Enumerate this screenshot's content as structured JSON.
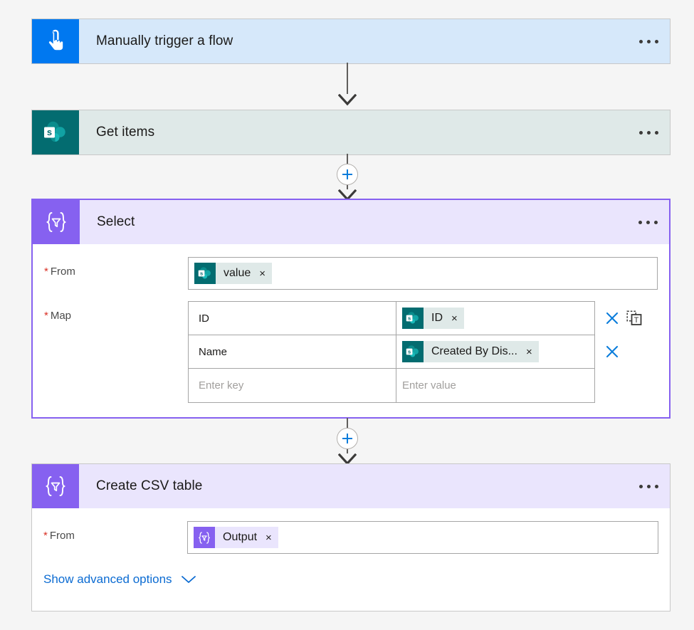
{
  "flow": {
    "trigger": {
      "title": "Manually trigger a flow",
      "icon": "manual-trigger-hand-icon",
      "menu_label": "more-commands",
      "accent": "#0078f0",
      "header_bg": "#d6e8fa"
    },
    "steps": [
      {
        "id": "get-items",
        "title": "Get items",
        "icon": "sharepoint-icon",
        "accent": "#036c70",
        "header_bg": "#dfe9e8"
      },
      {
        "id": "select",
        "title": "Select",
        "icon": "select-braces-filter-icon",
        "accent": "#8661f0",
        "header_bg": "#eae5fd",
        "selected": true,
        "fields": {
          "from": {
            "label": "From",
            "required": true,
            "token": {
              "text": "value",
              "source": "sharepoint",
              "remove": "×"
            }
          },
          "map": {
            "label": "Map",
            "required": true,
            "rows": [
              {
                "key": "ID",
                "key_placeholder": "",
                "value_token": {
                  "text": "ID",
                  "source": "sharepoint",
                  "remove": "×"
                },
                "value_placeholder": "",
                "actions": [
                  "delete-row-icon",
                  "paste-as-text-icon"
                ]
              },
              {
                "key": "Name",
                "key_placeholder": "",
                "value_token": {
                  "text": "Created By Dis...",
                  "source": "sharepoint",
                  "remove": "×"
                },
                "value_placeholder": "",
                "actions": [
                  "delete-row-icon"
                ]
              },
              {
                "key": "",
                "key_placeholder": "Enter key",
                "value_token": null,
                "value_placeholder": "Enter value",
                "actions": []
              }
            ]
          }
        }
      },
      {
        "id": "create-csv-table",
        "title": "Create CSV table",
        "icon": "select-braces-filter-icon",
        "accent": "#8661f0",
        "header_bg": "#eae5fd",
        "fields": {
          "from": {
            "label": "From",
            "required": true,
            "token": {
              "text": "Output",
              "source": "workflow",
              "remove": "×"
            }
          }
        },
        "advanced_options": {
          "label": "Show advanced options",
          "chevron": "chevron-down-icon"
        }
      }
    ],
    "connectors": [
      {
        "type": "arrow",
        "has_plus": false
      },
      {
        "type": "arrow",
        "has_plus": true,
        "plus_label": "+"
      },
      {
        "type": "arrow",
        "has_plus": true,
        "plus_label": "+"
      }
    ],
    "colors": {
      "page_bg": "#f5f5f5",
      "selection_border": "#8661f0",
      "link": "#0b6bd2",
      "required_star": "#d93025",
      "plus_blue": "#0b7ddb",
      "action_blue": "#0b7ddb"
    }
  }
}
